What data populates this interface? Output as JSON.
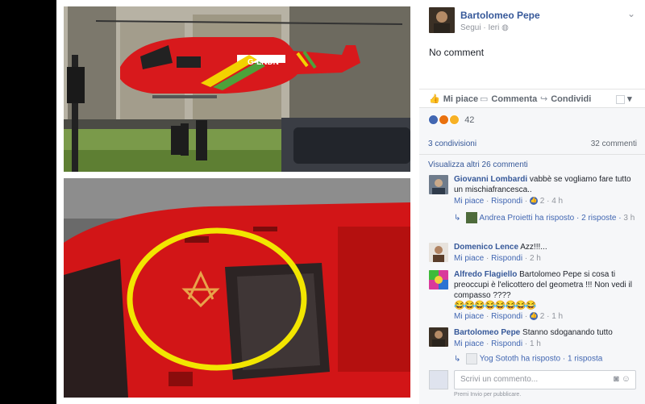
{
  "post": {
    "author": "Bartolomeo Pepe",
    "follow": "Segui",
    "time": "Ieri",
    "text": "No comment"
  },
  "photos": {
    "top_caption": "G-LNDN"
  },
  "actions": {
    "like": "Mi piace",
    "comment": "Commenta",
    "share": "Condividi"
  },
  "stats": {
    "reactions_count": "42",
    "shares": "3 condivisioni",
    "comments": "32 commenti",
    "view_more": "Visualizza altri 26 commenti"
  },
  "comments": [
    {
      "name": "Giovanni Lombardi",
      "text": "vabbè se vogliamo fare tutto un mischiafrancesca..",
      "like": "Mi piace",
      "reply": "Rispondi",
      "likes": "2",
      "time": "4 h",
      "replies": {
        "who": "Andrea Proietti ha risposto",
        "count": "2 risposte",
        "time": "3 h"
      }
    },
    {
      "name": "Domenico Lence",
      "text": "Azz!!!...",
      "like": "Mi piace",
      "reply": "Rispondi",
      "time": "2 h"
    },
    {
      "name": "Alfredo Flagiello",
      "text": "Bartolomeo Pepe si cosa ti preoccupi è l'elicottero del geometra !!! Non vedi il compasso ????",
      "emojis": "😂😂😂😂😂😂😂😂",
      "like": "Mi piace",
      "reply": "Rispondi",
      "likes": "2",
      "time": "1 h"
    },
    {
      "name": "Bartolomeo Pepe",
      "text": "Stanno sdoganando tutto",
      "like": "Mi piace",
      "reply": "Rispondi",
      "time": "1 h",
      "replies": {
        "who": "Yog Sototh ha risposto",
        "count": "1 risposta"
      }
    }
  ],
  "composer": {
    "placeholder": "Scrivi un commento...",
    "hint": "Premi Invio per pubblicare."
  },
  "colors": {
    "link": "#365899",
    "accent": "#4267b2",
    "helicopter_red": "#d8191c",
    "highlight_yellow": "#f2e600"
  }
}
